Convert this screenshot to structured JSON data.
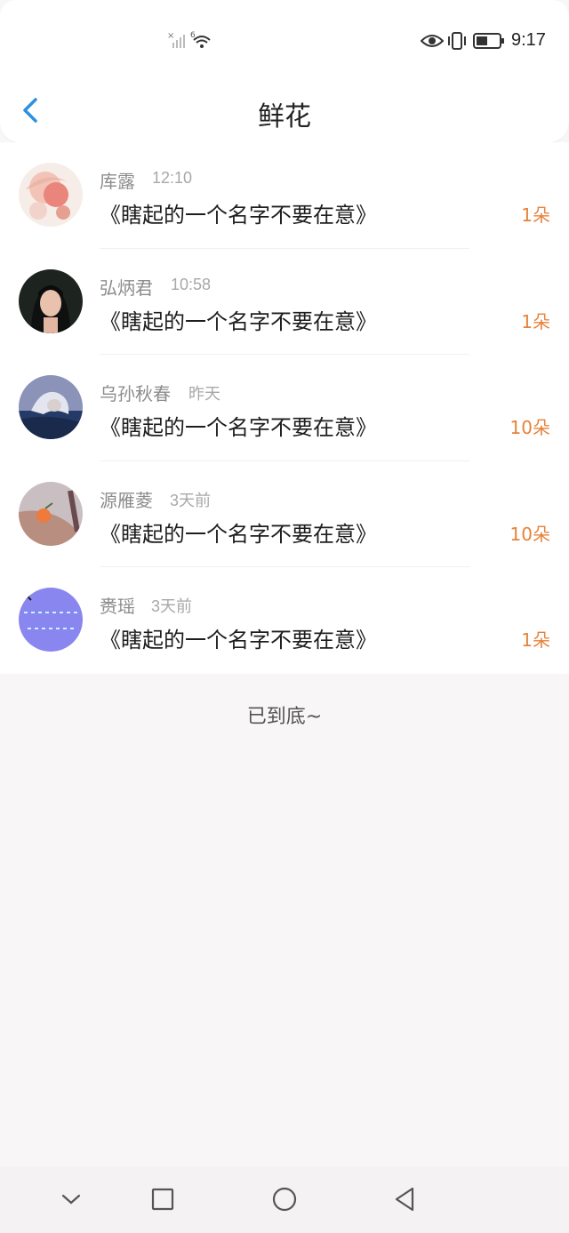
{
  "status_bar": {
    "time": "9:17"
  },
  "header": {
    "title": "鲜花"
  },
  "items": [
    {
      "name": "库露",
      "time": "12:10",
      "book": "《瞎起的一个名字不要在意》",
      "count": "1朵"
    },
    {
      "name": "弘炳君",
      "time": "10:58",
      "book": "《瞎起的一个名字不要在意》",
      "count": "1朵"
    },
    {
      "name": "乌孙秋春",
      "time": "昨天",
      "book": "《瞎起的一个名字不要在意》",
      "count": "10朵"
    },
    {
      "name": "源雁菱",
      "time": "3天前",
      "book": "《瞎起的一个名字不要在意》",
      "count": "10朵"
    },
    {
      "name": "赉瑶",
      "time": "3天前",
      "book": "《瞎起的一个名字不要在意》",
      "count": "1朵"
    }
  ],
  "footer": {
    "end_text": "已到底~"
  },
  "colors": {
    "accent": "#2d8fe0",
    "count": "#e7823a"
  }
}
